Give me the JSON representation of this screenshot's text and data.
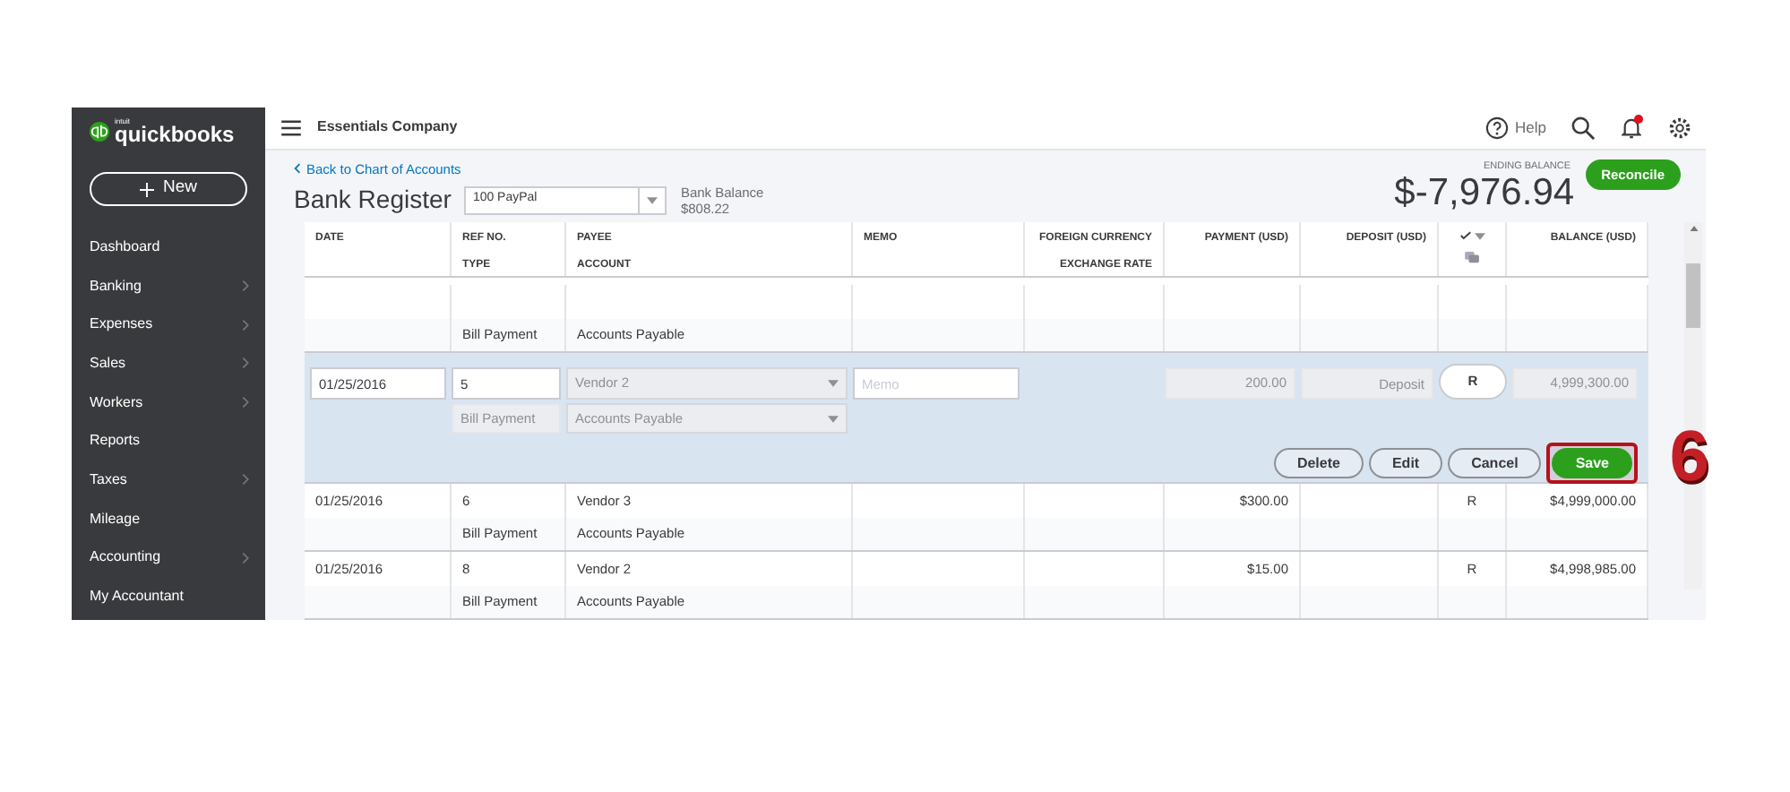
{
  "app": {
    "logo_small": "intuit",
    "logo": "quickbooks",
    "company": "Essentials Company",
    "help": "Help",
    "has_notification": true
  },
  "sidebar": {
    "new_button": "New",
    "items": [
      {
        "label": "Dashboard",
        "has_submenu": false
      },
      {
        "label": "Banking",
        "has_submenu": true
      },
      {
        "label": "Expenses",
        "has_submenu": true
      },
      {
        "label": "Sales",
        "has_submenu": true
      },
      {
        "label": "Workers",
        "has_submenu": true
      },
      {
        "label": "Reports",
        "has_submenu": false
      },
      {
        "label": "Taxes",
        "has_submenu": true
      },
      {
        "label": "Mileage",
        "has_submenu": false
      },
      {
        "label": "Accounting",
        "has_submenu": true
      },
      {
        "label": "My Accountant",
        "has_submenu": false
      }
    ]
  },
  "register": {
    "back_link": "Back to Chart of Accounts",
    "title": "Bank Register",
    "account": "100 PayPal",
    "bank_balance_label": "Bank Balance",
    "bank_balance": "$808.22",
    "ending_balance_label": "ENDING BALANCE",
    "ending_balance": "$-7,976.94",
    "reconcile": "Reconcile"
  },
  "table": {
    "columns": [
      {
        "kind": "text",
        "label": "DATE"
      },
      {
        "kind": "text",
        "label": "REF NO.",
        "sublabel": "TYPE"
      },
      {
        "kind": "text",
        "label": "PAYEE",
        "sublabel": "ACCOUNT"
      },
      {
        "kind": "text",
        "label": "MEMO"
      },
      {
        "kind": "text",
        "label": "FOREIGN CURRENCY",
        "sublabel": "EXCHANGE RATE"
      },
      {
        "kind": "text",
        "label": "PAYMENT (USD)"
      },
      {
        "kind": "text",
        "label": "DEPOSIT (USD)"
      },
      {
        "kind": "check"
      },
      {
        "kind": "text",
        "label": "BALANCE (USD)"
      }
    ],
    "rows": [
      {
        "kind": "entry",
        "type": "Bill Payment",
        "account": "Accounts Payable"
      },
      {
        "kind": "editing",
        "date": "01/25/2016",
        "ref": "5",
        "payee": "Vendor 2",
        "memo_placeholder": "Memo",
        "type": "Bill Payment",
        "account": "Accounts Payable",
        "payment": "200.00",
        "deposit_placeholder": "Deposit",
        "cleared": "R",
        "balance": "4,999,300.00",
        "actions": [
          {
            "label": "Delete",
            "kind": "secondary",
            "highlighted": false
          },
          {
            "label": "Edit",
            "kind": "secondary",
            "highlighted": false
          },
          {
            "label": "Cancel",
            "kind": "secondary",
            "highlighted": false
          },
          {
            "label": "Save",
            "kind": "primary",
            "highlighted": true
          }
        ],
        "annotation": "6"
      },
      {
        "kind": "entry",
        "date": "01/25/2016",
        "ref": "6",
        "payee": "Vendor 3",
        "type": "Bill Payment",
        "account": "Accounts Payable",
        "payment": "$300.00",
        "cleared": "R",
        "balance": "$4,999,000.00"
      },
      {
        "kind": "entry",
        "date": "01/25/2016",
        "ref": "8",
        "payee": "Vendor 2",
        "type": "Bill Payment",
        "account": "Accounts Payable",
        "payment": "$15.00",
        "cleared": "R",
        "balance": "$4,998,985.00"
      }
    ]
  }
}
